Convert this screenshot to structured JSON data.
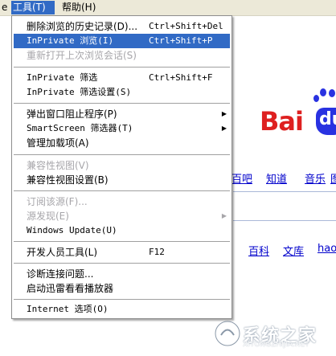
{
  "menubar": {
    "left_edge": "e",
    "tools": "工具(T)",
    "help": "帮助(H)"
  },
  "menu": {
    "items": [
      {
        "label": "删除浏览的历史记录(D)...",
        "shortcut": "Ctrl+Shift+Del",
        "state": "normal"
      },
      {
        "label": "InPrivate 浏览(I)",
        "shortcut": "Ctrl+Shift+P",
        "state": "highlight"
      },
      {
        "label": "重新打开上次浏览会话(S)",
        "shortcut": "",
        "state": "disabled"
      },
      {
        "label": "InPrivate 筛选",
        "shortcut": "Ctrl+Shift+F",
        "state": "normal"
      },
      {
        "label": "InPrivate 筛选设置(S)",
        "shortcut": "",
        "state": "normal"
      },
      {
        "label": "弹出窗口阻止程序(P)",
        "shortcut": "",
        "state": "normal",
        "submenu": true
      },
      {
        "label": "SmartScreen 筛选器(T)",
        "shortcut": "",
        "state": "normal",
        "submenu": true
      },
      {
        "label": "管理加载项(A)",
        "shortcut": "",
        "state": "normal"
      },
      {
        "label": "兼容性视图(V)",
        "shortcut": "",
        "state": "disabled"
      },
      {
        "label": "兼容性视图设置(B)",
        "shortcut": "",
        "state": "normal"
      },
      {
        "label": "订阅该源(F)...",
        "shortcut": "",
        "state": "disabled"
      },
      {
        "label": "源发现(E)",
        "shortcut": "",
        "state": "disabled",
        "submenu": true
      },
      {
        "label": "Windows Update(U)",
        "shortcut": "",
        "state": "normal"
      },
      {
        "label": "开发人员工具(L)",
        "shortcut": "F12",
        "state": "normal"
      },
      {
        "label": "诊断连接问题...",
        "shortcut": "",
        "state": "normal"
      },
      {
        "label": "启动迅雷看看播放器",
        "shortcut": "",
        "state": "normal"
      },
      {
        "label": "Internet 选项(O)",
        "shortcut": "",
        "state": "normal"
      }
    ]
  },
  "page": {
    "logo_text": "Bai",
    "logo_du": "du",
    "nav_links": [
      "百吧",
      "知道",
      "音乐",
      "图"
    ],
    "sub_links": [
      "百科",
      "文库",
      "hao"
    ]
  },
  "watermark": {
    "text": "系统之家",
    "url": "XITONGZHIJIA.NET"
  },
  "colors": {
    "highlight": "#316ac5",
    "baidu_red": "#de2020",
    "baidu_blue": "#2932e1",
    "link": "#0000cc",
    "disabled": "#a7a6aa"
  }
}
